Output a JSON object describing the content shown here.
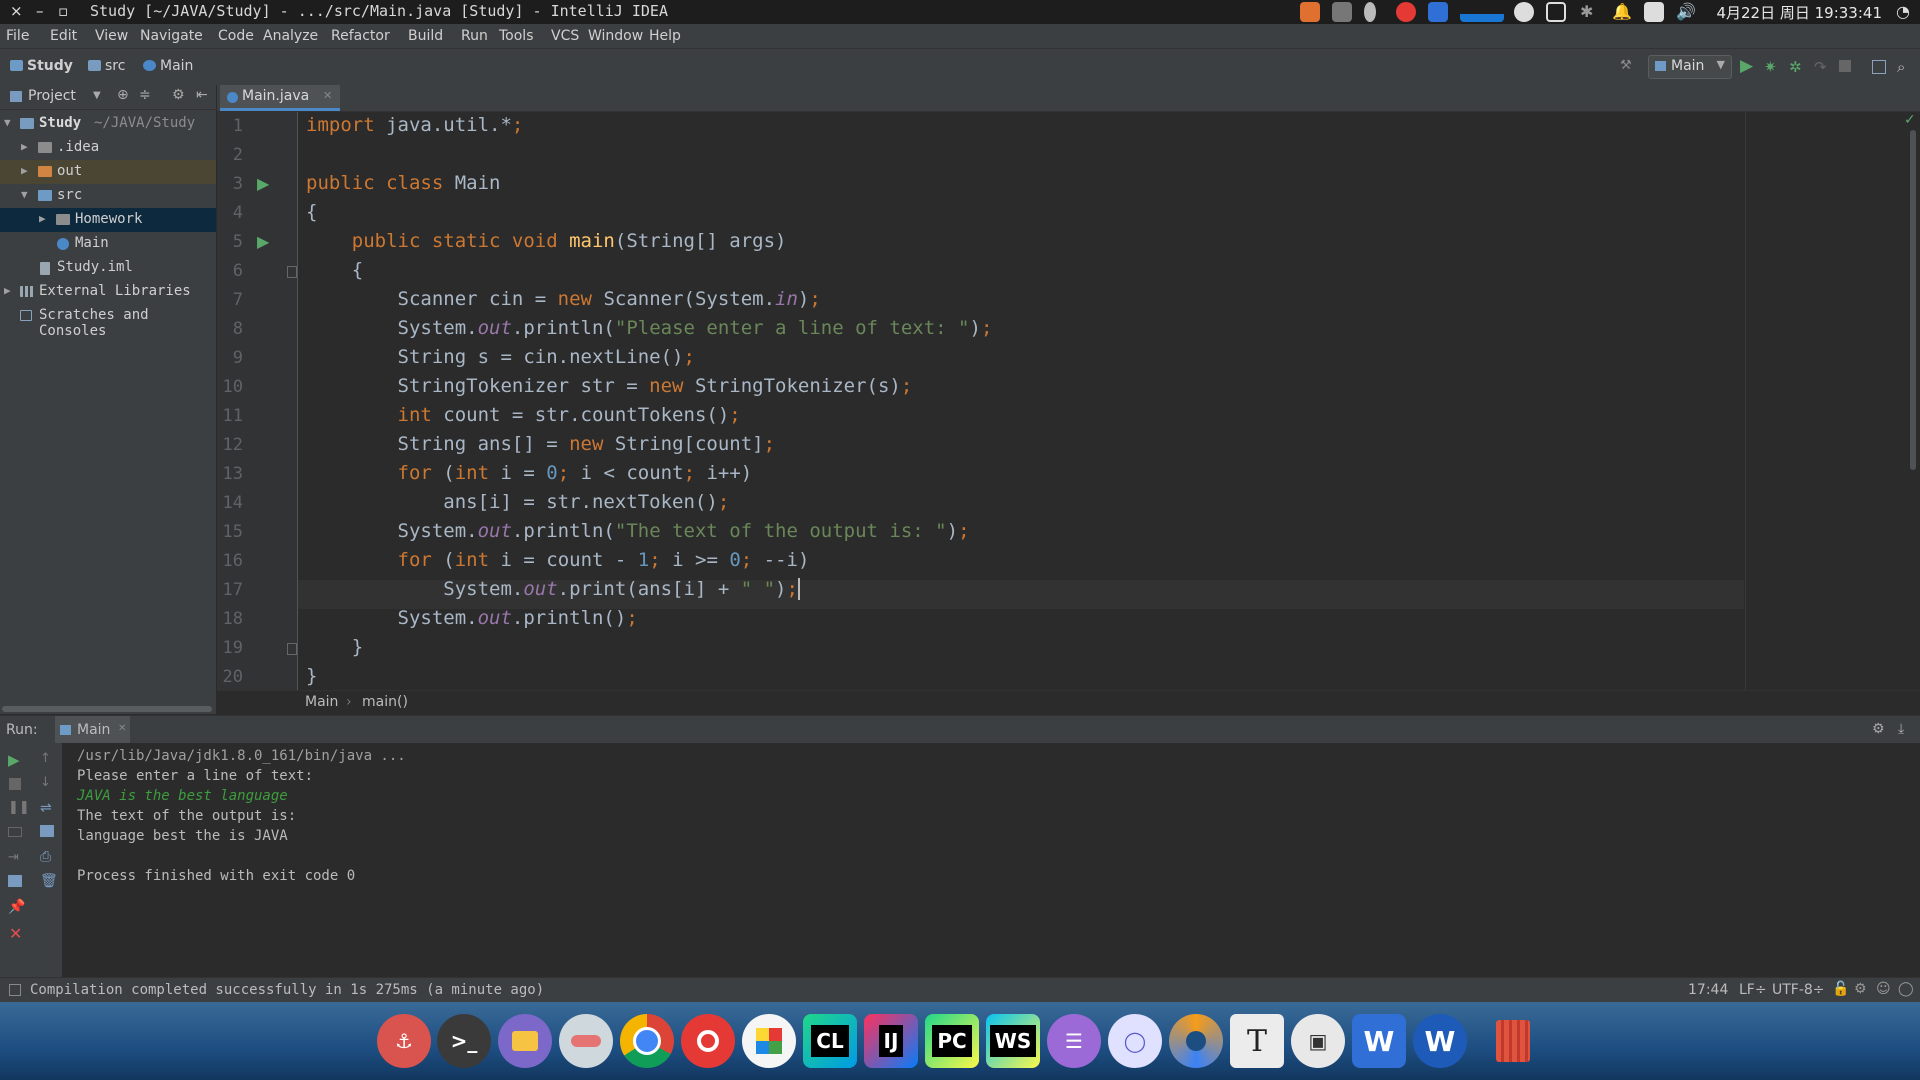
{
  "window": {
    "title": "Study [~/JAVA/Study] - .../src/Main.java [Study] - IntelliJ IDEA",
    "close_glyph": "×",
    "minimize_glyph": "–",
    "maximize_glyph": "▫"
  },
  "system": {
    "clock": "4月22日 周日 19:33:41"
  },
  "menubar": {
    "items": [
      "File",
      "Edit",
      "View",
      "Navigate",
      "Code",
      "Analyze",
      "Refactor",
      "Build",
      "Run",
      "Tools",
      "VCS",
      "Window",
      "Help"
    ]
  },
  "navbar": {
    "crumbs": [
      "Study",
      "src",
      "Main"
    ],
    "run_config": "Main"
  },
  "project": {
    "header": "Project",
    "tree": [
      {
        "label": "Study",
        "path": "~/JAVA/Study"
      },
      {
        "label": ".idea"
      },
      {
        "label": "out"
      },
      {
        "label": "src"
      },
      {
        "label": "Homework"
      },
      {
        "label": "Main"
      },
      {
        "label": "Study.iml"
      },
      {
        "label": "External Libraries"
      },
      {
        "label": "Scratches and Consoles"
      }
    ]
  },
  "editor": {
    "tab": "Main.java",
    "line_numbers": [
      "1",
      "2",
      "3",
      "4",
      "5",
      "6",
      "7",
      "8",
      "9",
      "10",
      "11",
      "12",
      "13",
      "14",
      "15",
      "16",
      "17",
      "18",
      "19",
      "20"
    ],
    "breadcrumb": [
      "Main",
      "main()"
    ]
  },
  "code_lines": [
    "import java.util.*;",
    "",
    "public class Main",
    "{",
    "    public static void main(String[] args)",
    "    {",
    "        Scanner cin = new Scanner(System.in);",
    "        System.out.println(\"Please enter a line of text: \");",
    "        String s = cin.nextLine();",
    "        StringTokenizer str = new StringTokenizer(s);",
    "        int count = str.countTokens();",
    "        String ans[] = new String[count];",
    "        for (int i = 0; i < count; i++)",
    "            ans[i] = str.nextToken();",
    "        System.out.println(\"The text of the output is: \");",
    "        for (int i = count - 1; i >= 0; --i)",
    "            System.out.print(ans[i] + \" \");",
    "        System.out.println();",
    "    }",
    "}"
  ],
  "run": {
    "label": "Run:",
    "tab": "Main",
    "output": [
      "/usr/lib/Java/jdk1.8.0_161/bin/java ...",
      "Please enter a line of text:",
      "JAVA is the best language",
      "The text of the output is:",
      "language best the is JAVA",
      "",
      "Process finished with exit code 0"
    ]
  },
  "status": {
    "message": "Compilation completed successfully in 1s 275ms (a minute ago)",
    "position": "17:44",
    "line_sep": "LF÷",
    "encoding": "UTF-8÷"
  },
  "dock": {
    "apps": [
      {
        "icon": "anchor-icon",
        "glyph": "⚓",
        "color": "#d9534f"
      },
      {
        "icon": "terminal-icon",
        "glyph": ">_",
        "color": "#3a3a3a"
      },
      {
        "icon": "purple-app-icon",
        "glyph": "",
        "color": "#7b68c8"
      },
      {
        "icon": "settings-toggle-icon",
        "glyph": "",
        "color": "#cfd8dc"
      },
      {
        "icon": "chrome-icon",
        "glyph": "",
        "color": "#4285f4"
      },
      {
        "icon": "netease-music-icon",
        "glyph": "",
        "color": "#e53935"
      },
      {
        "icon": "app-store-icon",
        "glyph": "",
        "color": "#f5f5f5"
      },
      {
        "icon": "clion-icon",
        "glyph": "CL",
        "color": "#21d789"
      },
      {
        "icon": "intellij-icon",
        "glyph": "IJ",
        "color": "#fe315d"
      },
      {
        "icon": "pycharm-icon",
        "glyph": "PC",
        "color": "#21d789"
      },
      {
        "icon": "webstorm-icon",
        "glyph": "WS",
        "color": "#07c3f2"
      },
      {
        "icon": "text-editor-icon",
        "glyph": "☰",
        "color": "#9c6ad6"
      },
      {
        "icon": "browser-ring-icon",
        "glyph": "◯",
        "color": "#e0e0ff"
      },
      {
        "icon": "swirl-app-icon",
        "glyph": "",
        "color": "#f59c1a"
      },
      {
        "icon": "typora-icon",
        "glyph": "T",
        "color": "#ececec"
      },
      {
        "icon": "remote-desktop-icon",
        "glyph": "▣",
        "color": "#e8e8e8"
      },
      {
        "icon": "wps-icon",
        "glyph": "W",
        "color": "#2f6fd6"
      },
      {
        "icon": "word-icon",
        "glyph": "W",
        "color": "#1e5bb8"
      },
      {
        "icon": "trash-icon",
        "glyph": "🗑",
        "color": "#e0533e"
      }
    ]
  }
}
